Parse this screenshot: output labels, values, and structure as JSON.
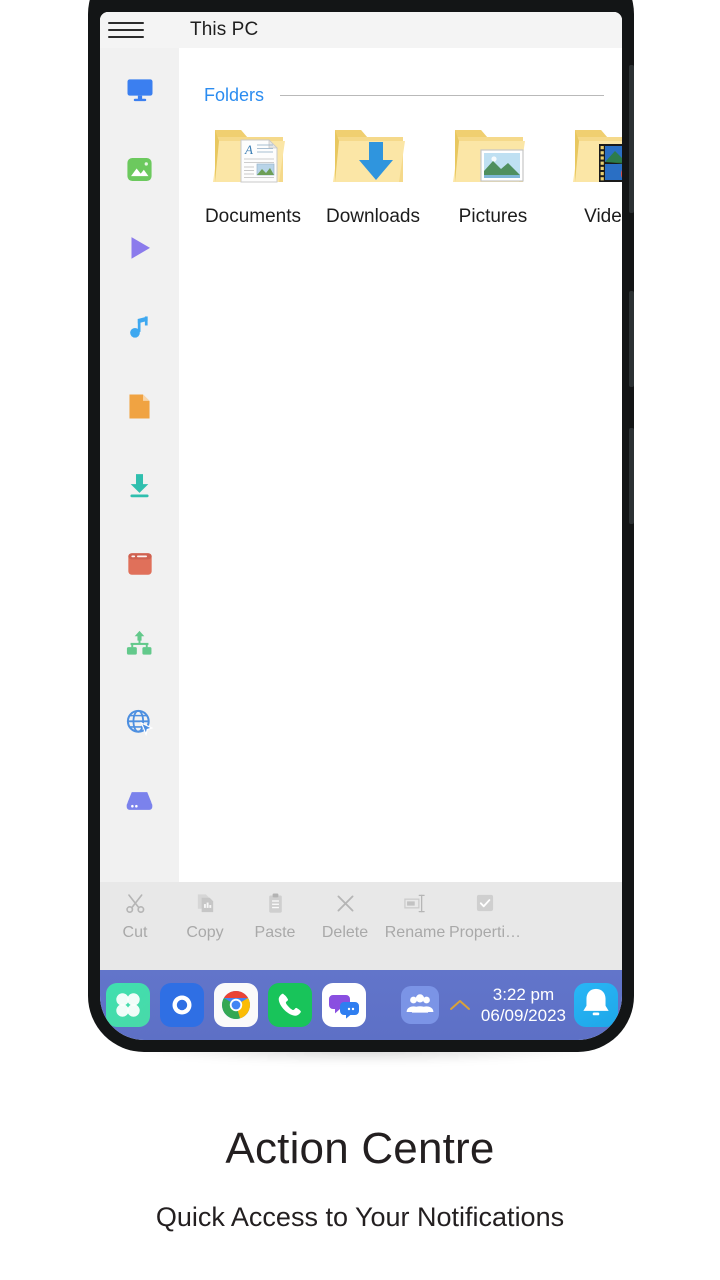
{
  "app": {
    "title": "This PC",
    "menu_icon": "hamburger-menu-icon"
  },
  "sidebar": {
    "items": [
      {
        "name": "this-pc",
        "icon": "monitor-icon",
        "color": "#3b7ff0"
      },
      {
        "name": "images",
        "icon": "image-icon",
        "color": "#6cc95e"
      },
      {
        "name": "videos",
        "icon": "play-icon",
        "color": "#8b7bec"
      },
      {
        "name": "audio",
        "icon": "music-note-icon",
        "color": "#3ea8f0"
      },
      {
        "name": "documents",
        "icon": "document-icon",
        "color": "#f0a342"
      },
      {
        "name": "downloads",
        "icon": "download-icon",
        "color": "#2fbfae"
      },
      {
        "name": "apps",
        "icon": "window-app-icon",
        "color": "#e0705a"
      },
      {
        "name": "network-share",
        "icon": "network-icon",
        "color": "#63c98b"
      },
      {
        "name": "remote-access",
        "icon": "globe-cursor-icon",
        "color": "#4d8fe0"
      },
      {
        "name": "storage",
        "icon": "hard-drive-icon",
        "color": "#7b82ec"
      }
    ]
  },
  "content": {
    "section_title": "Folders",
    "folders": [
      {
        "label": "Documents",
        "icon": "folder-documents-icon"
      },
      {
        "label": "Downloads",
        "icon": "folder-downloads-icon"
      },
      {
        "label": "Pictures",
        "icon": "folder-pictures-icon"
      },
      {
        "label": "Videos",
        "icon": "folder-videos-icon"
      }
    ]
  },
  "actionbar": {
    "items": [
      {
        "label": "Cut",
        "icon": "scissors-icon"
      },
      {
        "label": "Copy",
        "icon": "copy-icon"
      },
      {
        "label": "Paste",
        "icon": "clipboard-icon"
      },
      {
        "label": "Delete",
        "icon": "close-x-icon"
      },
      {
        "label": "Rename",
        "icon": "rename-icon"
      },
      {
        "label": "Properti…",
        "icon": "checkbox-icon"
      }
    ]
  },
  "taskbar": {
    "apps": [
      {
        "name": "app-drawer",
        "icon": "four-petal-icon"
      },
      {
        "name": "camera",
        "icon": "camera-ring-icon"
      },
      {
        "name": "chrome",
        "icon": "chrome-icon"
      },
      {
        "name": "phone",
        "icon": "phone-handset-icon"
      },
      {
        "name": "messages",
        "icon": "chat-bubbles-icon"
      }
    ],
    "tray": [
      {
        "name": "contacts",
        "icon": "people-group-icon"
      }
    ],
    "expand_icon": "chevron-up-icon",
    "time": "3:22 pm",
    "date": "06/09/2023",
    "notification_icon": "bell-icon"
  },
  "caption": {
    "title": "Action Centre",
    "subtitle": "Quick Access to Your Notifications"
  },
  "colors": {
    "accent_blue": "#2b8cf0",
    "taskbar": "#6275ca",
    "frame": "#131516",
    "sidebar_bg": "#f1f1f1",
    "actionbar_bg": "#e8e8e8"
  }
}
